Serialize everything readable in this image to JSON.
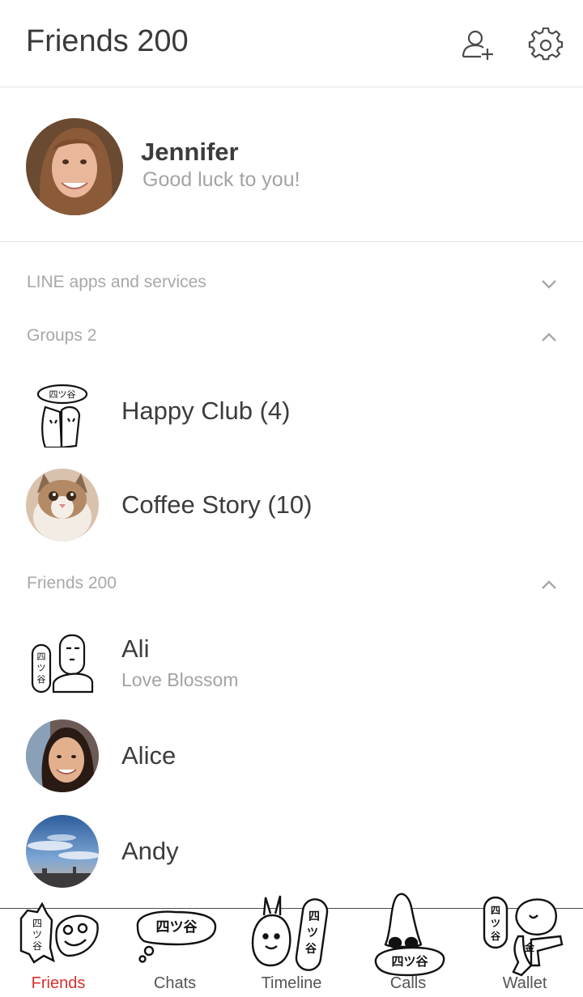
{
  "header": {
    "title": "Friends 200"
  },
  "profile": {
    "name": "Jennifer",
    "status": "Good luck to you!"
  },
  "sections": {
    "apps": "LINE apps and services",
    "groups": "Groups 2",
    "friends": "Friends 200"
  },
  "groups": [
    {
      "name": "Happy Club (4)"
    },
    {
      "name": "Coffee Story (10)"
    }
  ],
  "friends": [
    {
      "name": "Ali",
      "status": "Love Blossom"
    },
    {
      "name": "Alice"
    },
    {
      "name": "Andy"
    }
  ],
  "tabs": [
    {
      "label": "Friends",
      "active": true
    },
    {
      "label": "Chats"
    },
    {
      "label": "Timeline"
    },
    {
      "label": "Calls"
    },
    {
      "label": "Wallet"
    }
  ],
  "stickers": {
    "text": "四ツ谷",
    "wallet_badge": "金"
  },
  "colors": {
    "accent": "#d9302f",
    "muted": "#a8a8a8",
    "text": "#3c3c3c",
    "divider": "#e4e4e4"
  }
}
